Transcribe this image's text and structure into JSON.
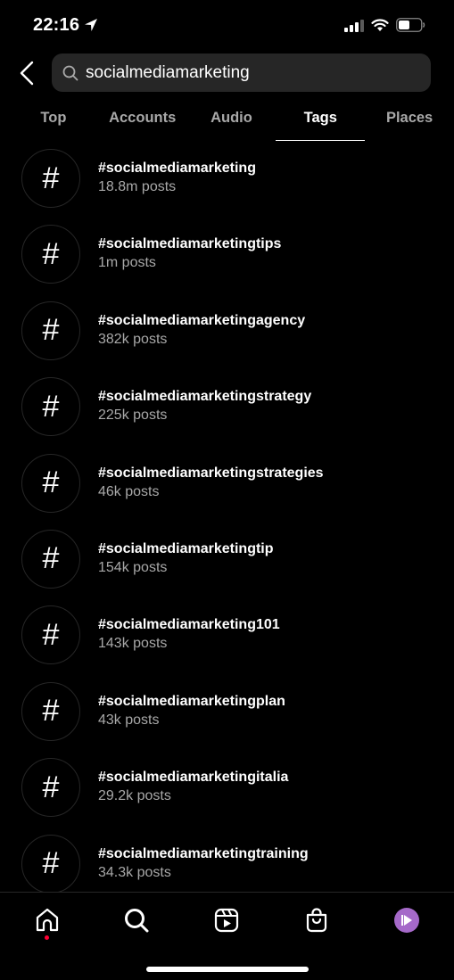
{
  "status_bar": {
    "time": "22:16",
    "icons": [
      "location-arrow-icon",
      "cellular-signal-icon",
      "wifi-icon",
      "battery-icon"
    ]
  },
  "search": {
    "value": "socialmediamarketing",
    "placeholder": "Search",
    "back_icon": "chevron-left-icon",
    "search_icon": "magnifier-icon"
  },
  "tabs": [
    {
      "label": "Top",
      "active": false
    },
    {
      "label": "Accounts",
      "active": false
    },
    {
      "label": "Audio",
      "active": false
    },
    {
      "label": "Tags",
      "active": true
    },
    {
      "label": "Places",
      "active": false
    }
  ],
  "results": [
    {
      "icon": "#",
      "name": "#socialmediamarketing",
      "count": "18.8m posts"
    },
    {
      "icon": "#",
      "name": "#socialmediamarketingtips",
      "count": "1m posts"
    },
    {
      "icon": "#",
      "name": "#socialmediamarketingagency",
      "count": "382k posts"
    },
    {
      "icon": "#",
      "name": "#socialmediamarketingstrategy",
      "count": "225k posts"
    },
    {
      "icon": "#",
      "name": "#socialmediamarketingstrategies",
      "count": "46k posts"
    },
    {
      "icon": "#",
      "name": "#socialmediamarketingtip",
      "count": "154k posts"
    },
    {
      "icon": "#",
      "name": "#socialmediamarketing101",
      "count": "143k posts"
    },
    {
      "icon": "#",
      "name": "#socialmediamarketingplan",
      "count": "43k posts"
    },
    {
      "icon": "#",
      "name": "#socialmediamarketingitalia",
      "count": "29.2k posts"
    },
    {
      "icon": "#",
      "name": "#socialmediamarketingtraining",
      "count": "34.3k posts"
    }
  ],
  "bottom_nav": {
    "items": [
      "home-icon",
      "search-icon",
      "reels-icon",
      "shop-icon",
      "profile-avatar"
    ],
    "home_has_notification": true,
    "notification_color": "#ff0033",
    "avatar_color": "#a569c9"
  }
}
